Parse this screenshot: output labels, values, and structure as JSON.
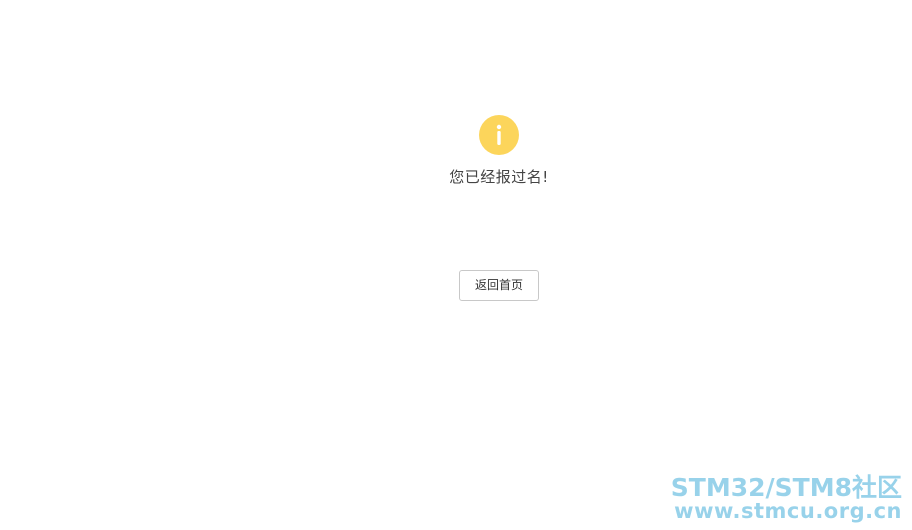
{
  "notice": {
    "icon": "info-icon",
    "icon_color": "#fcd55b",
    "message": "您已经报过名!"
  },
  "actions": {
    "home_button_label": "返回首页"
  },
  "watermark": {
    "line1": "STM32/STM8社区",
    "line2": "www.stmcu.org.cn",
    "color": "#6dc0e2"
  }
}
